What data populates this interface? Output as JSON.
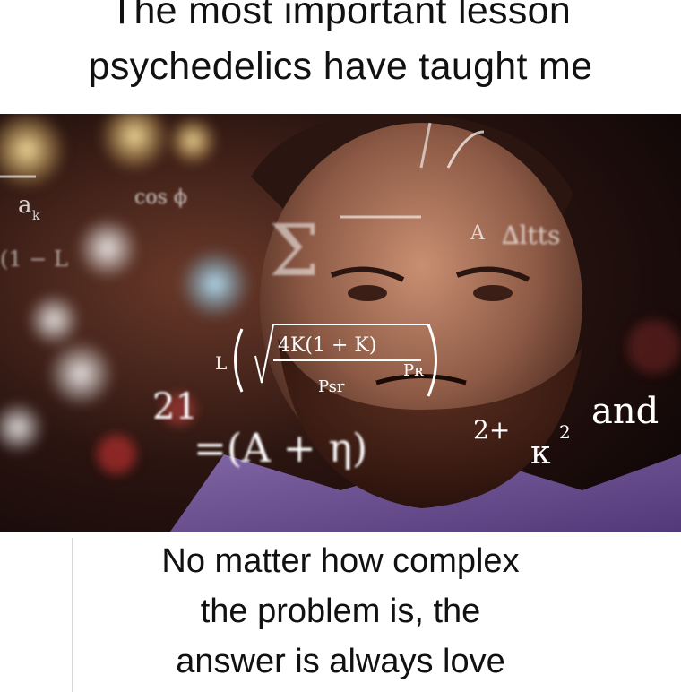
{
  "top_caption": {
    "line1": "The most important lesson",
    "line2": "psychedelics have taught me"
  },
  "photo": {
    "equations": {
      "main_number": "21",
      "main_eq": "=(A + η)",
      "exponent": "2+",
      "kappa": "κ",
      "kappa_exp": "2",
      "and_word": "and",
      "sqrt_num": "4K(1 + K)",
      "sqrt_den": "Psr",
      "p_sub": "Pʀ",
      "l_paren": "L",
      "cos": "cos ϕ",
      "a_k": "a",
      "a_k_sub": "k",
      "one_minus": "(1 − L",
      "sigma": "Σ",
      "small_a": "A",
      "ratio": "∆ltts"
    }
  },
  "bottom_caption": {
    "line1": "No matter how complex",
    "line2": "the problem is, the",
    "line3": "answer is always love"
  }
}
